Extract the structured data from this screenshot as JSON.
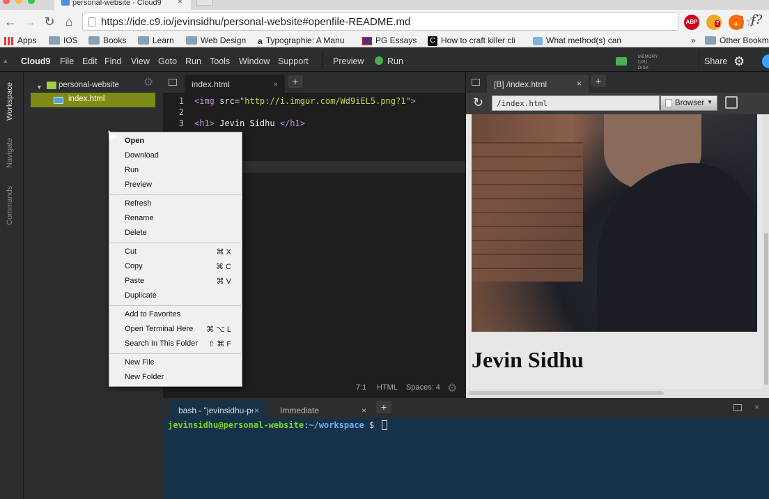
{
  "browser": {
    "tab_title": "personal-website - Cloud9",
    "tab_close": "×",
    "url": "https://ide.c9.io/jevinsidhu/personal-website#openfile-README.md",
    "extensions": {
      "bitwarden": "B",
      "abp": "ABP",
      "badge_count": "7",
      "fx": "f?"
    },
    "bookmarks": [
      {
        "label": "Apps"
      },
      {
        "label": "IOS"
      },
      {
        "label": "Books"
      },
      {
        "label": "Learn"
      },
      {
        "label": "Web Design"
      },
      {
        "label": "Typographie: A Manu"
      },
      {
        "label": "PG Essays"
      },
      {
        "label": "How to craft killer cli"
      },
      {
        "label": "What method(s) can"
      },
      {
        "label": "Other Bookm"
      }
    ],
    "bookmarks_overflow": "»"
  },
  "ide": {
    "brand": "Cloud9",
    "menu": [
      "File",
      "Edit",
      "Find",
      "View",
      "Goto",
      "Run",
      "Tools",
      "Window",
      "Support"
    ],
    "preview_label": "Preview",
    "run_label": "Run",
    "meters": [
      "MEMORY",
      "CPU",
      "DISK"
    ],
    "share_label": "Share",
    "vtabs": [
      "Workspace",
      "Navigate",
      "Commands"
    ],
    "tree": {
      "root": "personal-website",
      "file": "index.html"
    },
    "editor": {
      "tab": "index.html",
      "tab_close": "×",
      "new_tab": "+",
      "lines": [
        "1",
        "2",
        "3"
      ],
      "code": {
        "l1_open": "<img ",
        "l1_attr": "src=",
        "l1_str": "\"http://i.imgur.com/Wd9iEL5.png?1\"",
        "l1_close": ">",
        "l3_open": "<h1>",
        "l3_text": " Jevin Sidhu ",
        "l3_close": "</h1>"
      },
      "status": {
        "position": "7:1",
        "mode": "HTML",
        "spaces": "Spaces: 4"
      }
    },
    "preview": {
      "tab": "[B] /index.html",
      "tab_close": "×",
      "new_tab": "+",
      "url": "/index.html",
      "browser_btn": "Browser",
      "heading": "Jevin Sidhu"
    },
    "terminal": {
      "tab1": "bash - \"jevinsidhu-pe",
      "tab2": "Immediate",
      "tab_close": "×",
      "new_tab": "+",
      "close_panel": "×",
      "user": "jevinsidhu@personal-website",
      "colon": ":",
      "path": "~/workspace",
      "prompt": " $ "
    }
  },
  "context_menu": {
    "items": [
      {
        "label": "Open",
        "bold": true
      },
      {
        "label": "Download"
      },
      {
        "label": "Run"
      },
      {
        "label": "Preview"
      },
      {
        "label": "Refresh"
      },
      {
        "label": "Rename"
      },
      {
        "label": "Delete"
      },
      {
        "label": "Cut",
        "shortcut": "⌘ X"
      },
      {
        "label": "Copy",
        "shortcut": "⌘ C"
      },
      {
        "label": "Paste",
        "shortcut": "⌘ V"
      },
      {
        "label": "Duplicate"
      },
      {
        "label": "Add to Favorites"
      },
      {
        "label": "Open Terminal Here",
        "shortcut": "⌘ ⌥ L"
      },
      {
        "label": "Search In This Folder",
        "shortcut": "⇧ ⌘ F"
      },
      {
        "label": "New File"
      },
      {
        "label": "New Folder"
      }
    ]
  },
  "colors": {
    "ide_bg": "#2c2d2e",
    "editor_bg": "#1e1e1e",
    "tree_selection": "#7e8c15",
    "terminal_bg": "#153249",
    "run_green": "#4caf50"
  }
}
